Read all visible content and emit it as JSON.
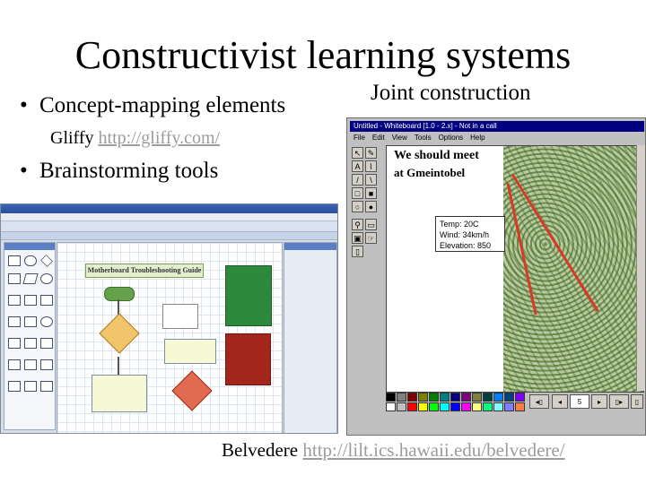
{
  "slide": {
    "title": "Constructivist learning systems",
    "bullet1": "Concept-mapping elements",
    "gliffy_label": "Gliffy",
    "gliffy_url": "http://gliffy.com/",
    "bullet2": "Brainstorming tools",
    "joint_heading": "Joint construction",
    "belvedere_label": "Belvedere",
    "belvedere_url": "http://lilt.ics.hawaii.edu/belvedere/",
    "bullet_glyph": "•"
  },
  "gliffy_screenshot": {
    "diagram_title": "Motherboard Troubleshooting Guide"
  },
  "belvedere_screenshot": {
    "window_title": "Untitled - Whiteboard [1.0 - 2.x] - Not in a call",
    "menu": [
      "File",
      "Edit",
      "View",
      "Tools",
      "Options",
      "Help"
    ],
    "note_line1": "We should meet",
    "note_line2": "at Gmeintobel",
    "weather": [
      "Temp: 20C",
      "Wind: 34km/h",
      "Elevation: 850"
    ],
    "page_number": "5",
    "map_color": "#9bb27a",
    "line_color": "#d83a2a"
  }
}
